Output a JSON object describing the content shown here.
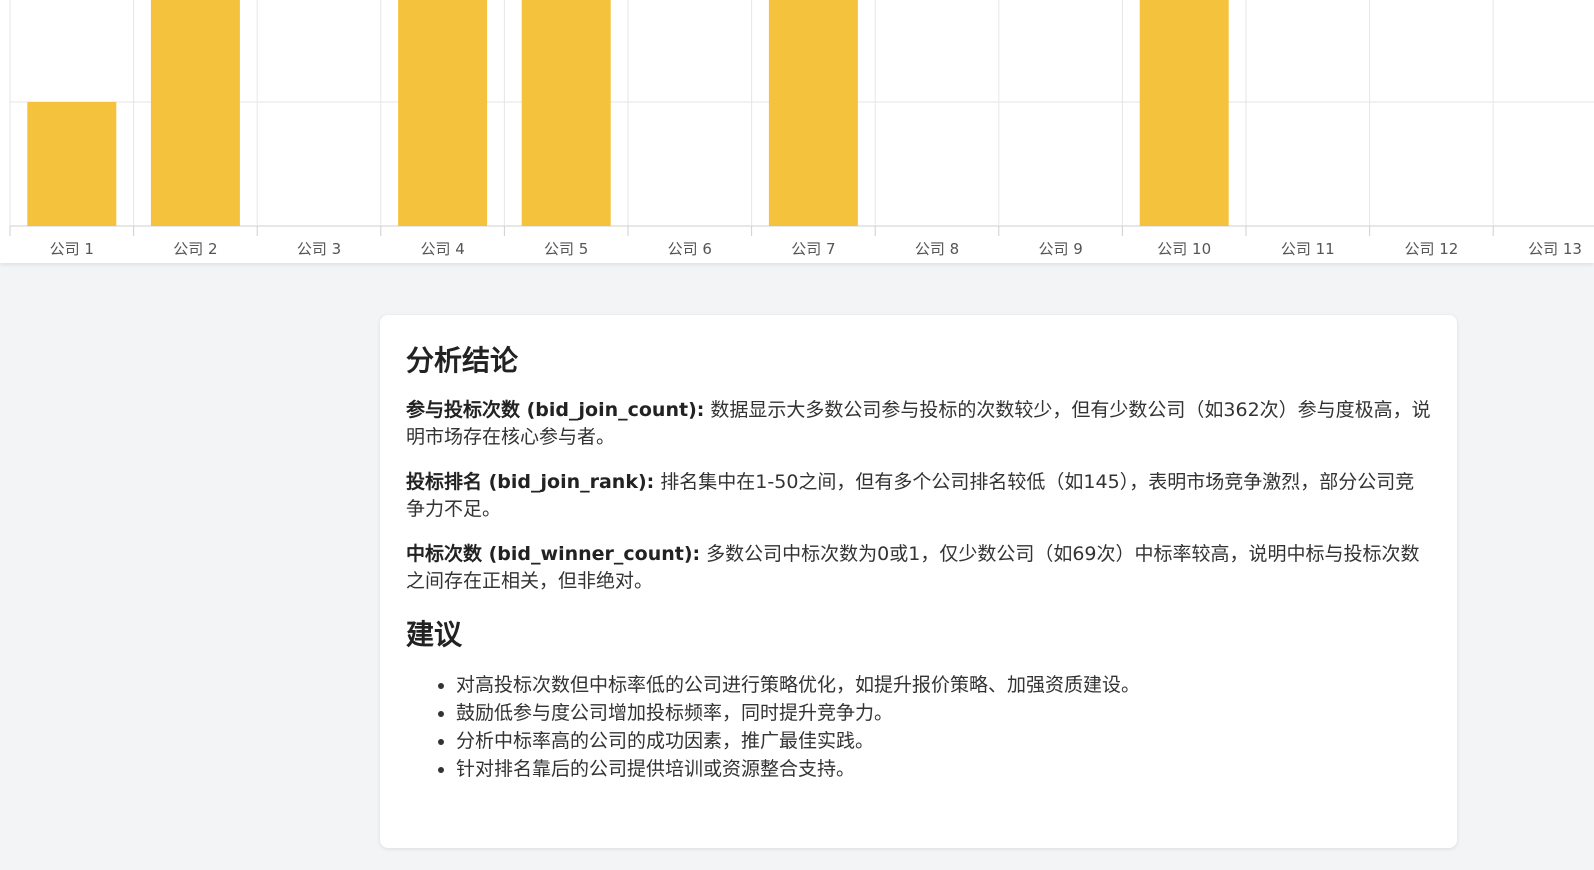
{
  "chart_data": {
    "type": "bar",
    "categories": [
      "公司 1",
      "公司 2",
      "公司 3",
      "公司 4",
      "公司 5",
      "公司 6",
      "公司 7",
      "公司 8",
      "公司 9",
      "公司 10",
      "公司 11",
      "公司 12",
      "公司 13"
    ],
    "values": [
      1,
      20,
      0,
      20,
      20,
      0,
      20,
      0,
      0,
      2,
      0,
      0,
      0
    ],
    "ylim": [
      0,
      2
    ],
    "color": "#f5c23e",
    "grid": true
  },
  "analysis": {
    "title": "分析结论",
    "items": [
      {
        "term": "参与投标次数 (bid_join_count):",
        "text": " 数据显示大多数公司参与投标的次数较少，但有少数公司（如362次）参与度极高，说明市场存在核心参与者。"
      },
      {
        "term": "投标排名 (bid_join_rank):",
        "text": " 排名集中在1-50之间，但有多个公司排名较低（如145），表明市场竞争激烈，部分公司竞争力不足。"
      },
      {
        "term": "中标次数 (bid_winner_count):",
        "text": " 多数公司中标次数为0或1，仅少数公司（如69次）中标率较高，说明中标与投标次数之间存在正相关，但非绝对。"
      }
    ]
  },
  "recommendations": {
    "title": "建议",
    "items": [
      "对高投标次数但中标率低的公司进行策略优化，如提升报价策略、加强资质建设。",
      "鼓励低参与度公司增加投标频率，同时提升竞争力。",
      "分析中标率高的公司的成功因素，推广最佳实践。",
      "针对排名靠后的公司提供培训或资源整合支持。"
    ]
  }
}
